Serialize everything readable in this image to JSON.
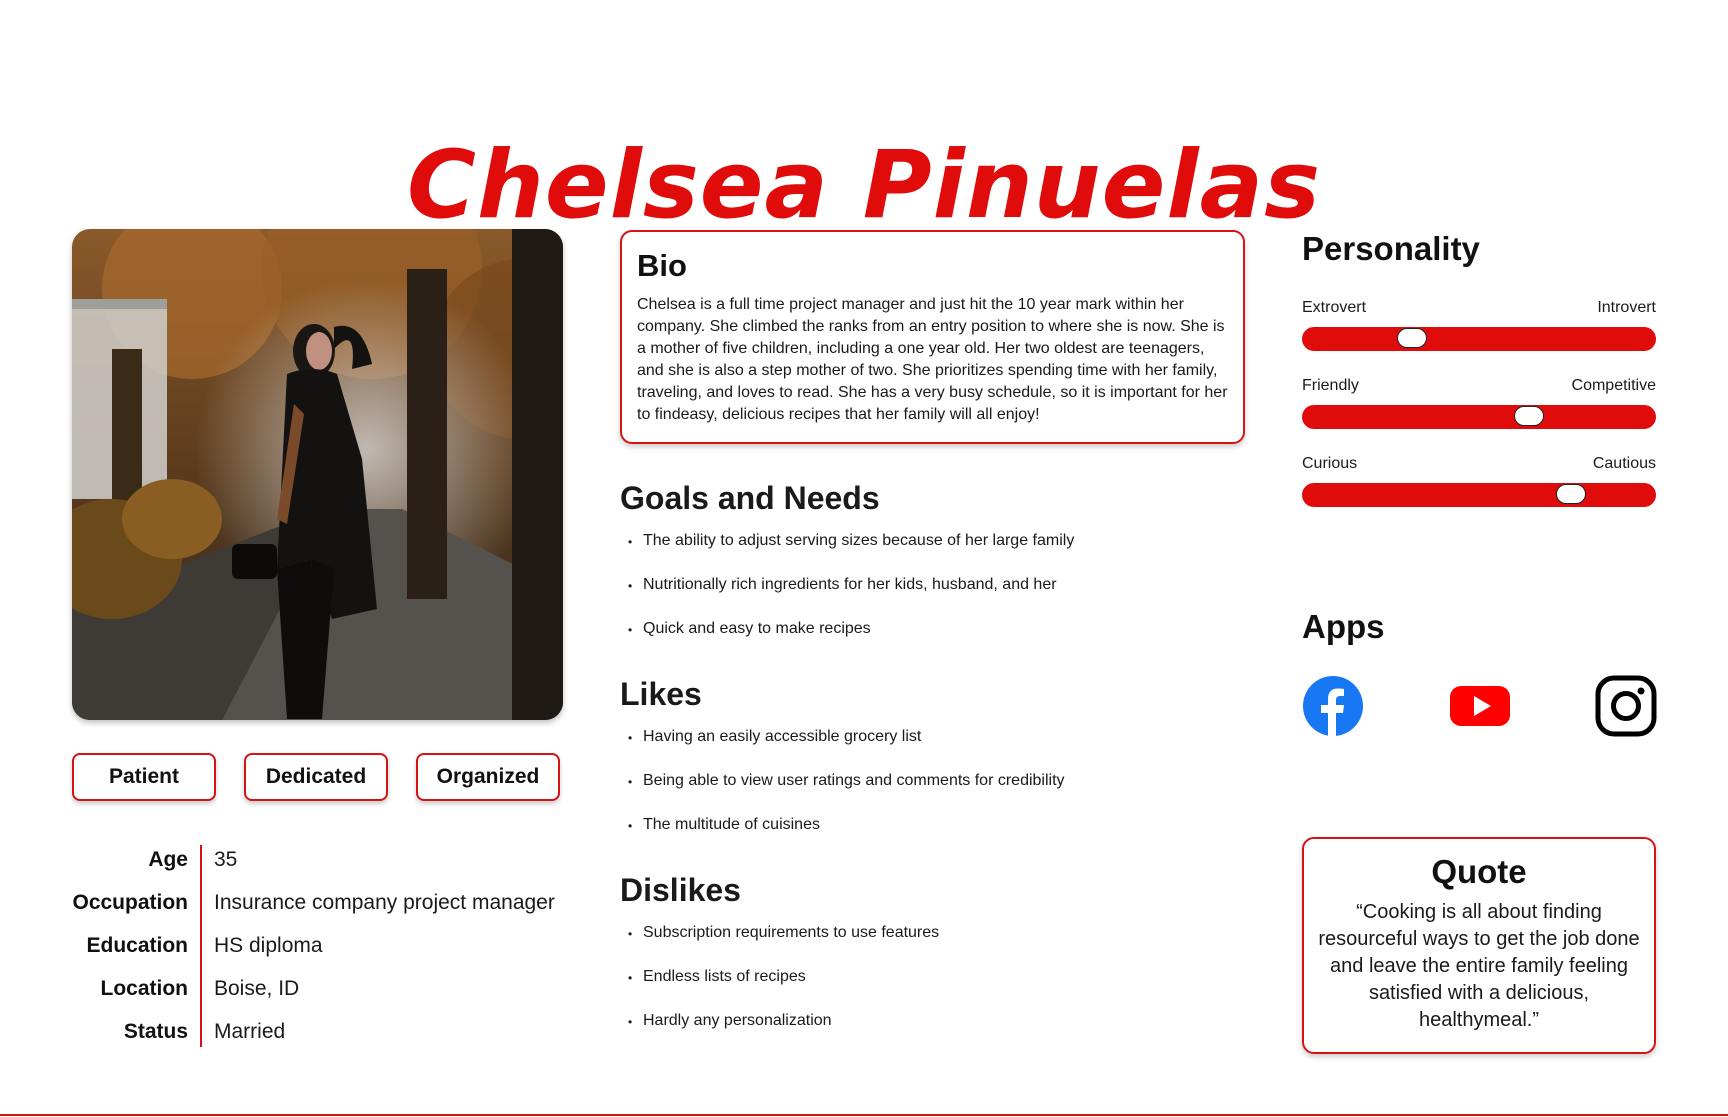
{
  "name": "Chelsea Pinuelas",
  "traits": [
    "Patient",
    "Dedicated",
    "Organized"
  ],
  "demographics": [
    {
      "label": "Age",
      "value": "35"
    },
    {
      "label": "Occupation",
      "value": "Insurance company project manager"
    },
    {
      "label": "Education",
      "value": "HS diploma"
    },
    {
      "label": "Location",
      "value": "Boise, ID"
    },
    {
      "label": "Status",
      "value": "Married"
    }
  ],
  "bio": {
    "title": "Bio",
    "text": "Chelsea is a full time project manager and just hit the 10 year mark within her company. She climbed the ranks from an entry position to  where she is now. She is a mother of five children, including a one year old. Her two oldest are teenagers, and she is also a step mother of two. She prioritizes spending time with her family, traveling, and loves to read. She has a very busy schedule, so it is important for her to findeasy, delicious recipes that her family will all enjoy!"
  },
  "goals": {
    "title": "Goals and Needs",
    "items": [
      "The ability to adjust serving sizes because of her large family",
      "Nutritionally rich ingredients for her kids, husband, and her",
      "Quick and easy to make recipes"
    ]
  },
  "likes": {
    "title": "Likes",
    "items": [
      "Having an easily accessible grocery list",
      "Being able to view user ratings and comments for credibility",
      "The multitude of cuisines"
    ]
  },
  "dislikes": {
    "title": "Dislikes",
    "items": [
      "Subscription requirements to use features",
      "Endless lists of recipes",
      "Hardly any personalization"
    ]
  },
  "personality": {
    "title": "Personality",
    "sliders": [
      {
        "left": "Extrovert",
        "right": "Introvert",
        "level": 0.31
      },
      {
        "left": "Friendly",
        "right": "Competitive",
        "level": 0.64
      },
      {
        "left": "Curious",
        "right": "Cautious",
        "level": 0.76
      }
    ]
  },
  "apps": {
    "title": "Apps",
    "icons": [
      "facebook-icon",
      "youtube-icon",
      "instagram-icon"
    ]
  },
  "quote": {
    "title": "Quote",
    "text": "“Cooking is all about finding resourceful ways to get the job done and leave the entire family feeling satisfied with a delicious, healthymeal.”"
  },
  "colors": {
    "accent": "#e00b0b",
    "border": "#d41414",
    "facebook": "#1877f2",
    "youtube": "#ff0000"
  }
}
